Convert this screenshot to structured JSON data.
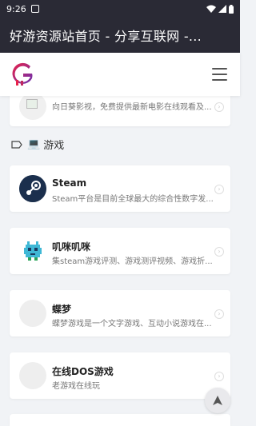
{
  "status_bar": {
    "time": "9:26"
  },
  "title_bar": {
    "title": "好游资源站首页 - 分享互联网 -..."
  },
  "partial_card": {
    "desc": "向日葵影视，免费提供最新电影在线观看及..."
  },
  "section": {
    "label": "游戏"
  },
  "cards": [
    {
      "name": "Steam",
      "desc": "Steam平台是目前全球最大的综合性数字发..."
    },
    {
      "name": "叽咪叽咪",
      "desc": "集steam游戏评测、游戏测评视频、游戏折..."
    },
    {
      "name": "蝶梦",
      "desc": "蝶梦游戏是一个文字游戏、互动小说游戏在..."
    },
    {
      "name": "在线DOS游戏",
      "desc": "老游戏在线玩"
    }
  ],
  "colors": {
    "bar": "#2a2a35",
    "bg": "#f1f3f6",
    "logo_red": "#e8234a",
    "logo_purple": "#6a2fb0"
  },
  "icons": [
    "wifi-icon",
    "signal-icon",
    "battery-icon",
    "menu-icon",
    "tag-icon",
    "laptop-icon",
    "steam-icon",
    "pixel-alien-icon",
    "back-to-top-icon"
  ]
}
